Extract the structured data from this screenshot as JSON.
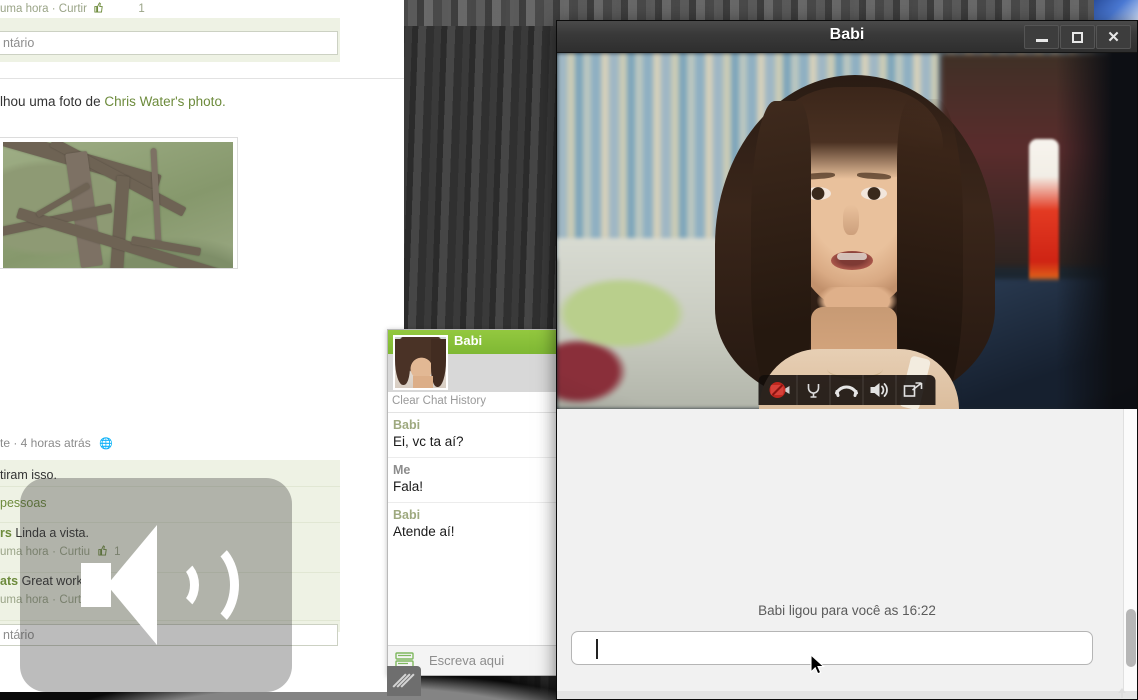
{
  "desktop": {
    "name": "desktop-wallpaper"
  },
  "facebook_page": {
    "top_post_meta": "uma hora · Curtir",
    "top_post_like_count": "1",
    "comment_placeholder_top": "ntário",
    "story_text_prefix": "lhou uma foto de ",
    "story_link": "Chris Water's photo.",
    "photo_meta": "te · 4 horas atrás",
    "likes_line": "tiram isso.",
    "people_link": "pessoas",
    "comments": [
      {
        "author_fragment": "rs",
        "text": "Linda a vista.",
        "meta_time": "uma hora",
        "meta_action": "Curtiu",
        "like_count": "1"
      },
      {
        "author_fragment": "ats",
        "text": "Great work ma",
        "meta_time": "uma hora",
        "meta_action": "Curt"
      }
    ],
    "comment_placeholder_bottom": "ntário"
  },
  "volume_osd": {
    "icon": "speaker-volume-icon"
  },
  "chat_window": {
    "contact_name": "Babi",
    "clear_history_label": "Clear Chat History",
    "messages": [
      {
        "author": "Babi",
        "text": "Ei, vc ta aí?",
        "is_me": false
      },
      {
        "author": "Me",
        "text": "Fala!",
        "is_me": true
      },
      {
        "author": "Babi",
        "text": "Atende aí!",
        "is_me": false
      }
    ],
    "input_placeholder": "Escreva aqui",
    "input_icon": "keyboard-icon"
  },
  "video_window": {
    "title": "Babi",
    "window_buttons": [
      {
        "name": "minimize-button",
        "glyph": "—"
      },
      {
        "name": "maximize-button",
        "glyph": "□"
      },
      {
        "name": "close-button",
        "glyph": "✕"
      }
    ],
    "call_toolbar": [
      {
        "name": "camera-off-icon",
        "label": "Camera"
      },
      {
        "name": "microphone-icon",
        "label": "Microphone"
      },
      {
        "name": "hang-up-icon",
        "label": "End call"
      },
      {
        "name": "speaker-icon",
        "label": "Speaker"
      },
      {
        "name": "fullscreen-icon",
        "label": "Fullscreen"
      }
    ],
    "status_text": "Babi ligou para você as 16:22",
    "message_input_value": "",
    "colors": {
      "titlebar": "#3a3a3a",
      "chat_bg": "#f1f1f1",
      "accent_green": "#8cc63e",
      "camera_red": "#d8281e"
    }
  }
}
